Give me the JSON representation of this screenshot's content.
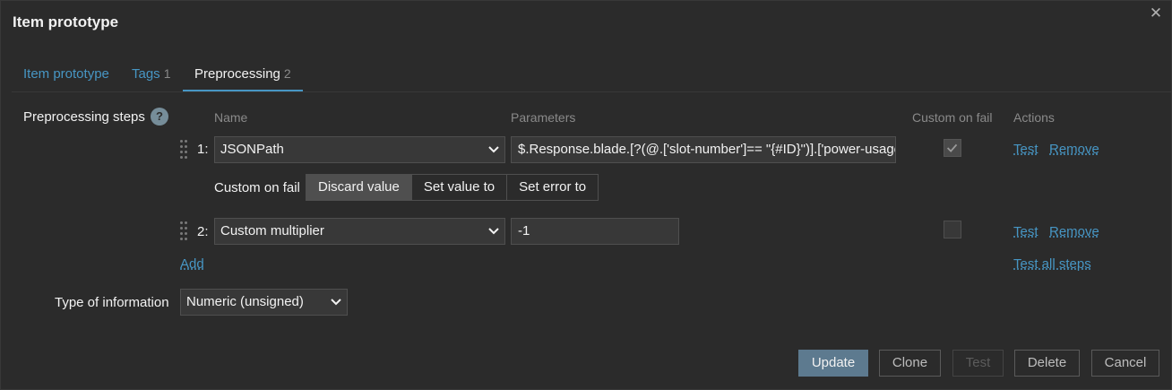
{
  "dialog": {
    "title": "Item prototype"
  },
  "tabs": [
    {
      "label": "Item prototype",
      "count": ""
    },
    {
      "label": "Tags",
      "count": "1"
    },
    {
      "label": "Preprocessing",
      "count": "2"
    }
  ],
  "preprocessing": {
    "label": "Preprocessing steps",
    "help": "?",
    "headers": {
      "name": "Name",
      "parameters": "Parameters",
      "custom_on_fail": "Custom on fail",
      "actions": "Actions"
    },
    "steps": [
      {
        "num": "1:",
        "name": "JSONPath",
        "parameter": "$.Response.blade.[?(@.['slot-number']== \"{#ID}\")].['power-usage']",
        "custom_on_fail": true,
        "test": "Test",
        "remove": "Remove"
      },
      {
        "num": "2:",
        "name": "Custom multiplier",
        "parameter": "-1",
        "custom_on_fail": false,
        "test": "Test",
        "remove": "Remove"
      }
    ],
    "custom_on_fail_row": {
      "label": "Custom on fail",
      "options": [
        "Discard value",
        "Set value to",
        "Set error to"
      ],
      "selected": "Discard value"
    },
    "add": "Add",
    "test_all": "Test all steps"
  },
  "type_of_information": {
    "label": "Type of information",
    "value": "Numeric (unsigned)"
  },
  "footer": {
    "update": "Update",
    "clone": "Clone",
    "test": "Test",
    "delete": "Delete",
    "cancel": "Cancel"
  },
  "colors": {
    "background": "#2b2b2b",
    "link": "#4796c4",
    "primary_button": "#5d7a8f"
  }
}
